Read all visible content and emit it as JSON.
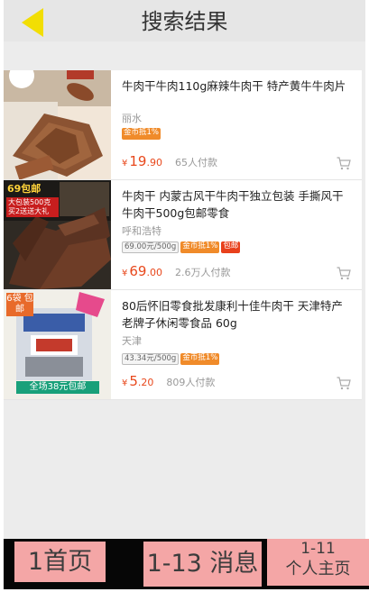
{
  "header": {
    "title": "搜索结果"
  },
  "colors": {
    "accent": "#e8481c",
    "back_arrow": "#f2de04",
    "tab_bg": "#f4a6a6",
    "coin_tag": "#f08b2a",
    "mail_tag": "#e8401c"
  },
  "results": [
    {
      "title": "牛肉干牛肉110g麻辣牛肉干 特产黄牛牛肉片",
      "location": "丽水",
      "tags": [
        "金币抵1%"
      ],
      "currency": "¥",
      "price_int": "19",
      "price_dec": ".90",
      "sales": "65人付款",
      "image": {
        "icon": "beef-jerky-image",
        "overlay": "",
        "promo": ""
      }
    },
    {
      "title": "牛肉干 内蒙古风干牛肉干独立包装 手撕风干牛肉干500g包邮零食",
      "location": "呼和浩特",
      "tags": [
        "69.00元/500g",
        "金币抵1%",
        "包邮"
      ],
      "currency": "¥",
      "price_int": "69",
      "price_dec": ".00",
      "sales": "2.6万人付款",
      "image": {
        "icon": "beef-jerky-image",
        "overlay": "69包邮",
        "promo": "大包装500克 买2送送大礼"
      }
    },
    {
      "title": "80后怀旧零食批发康利十佳牛肉干 天津特产老牌子休闲零食品 60g",
      "location": "天津",
      "tags": [
        "43.34元/500g",
        "金币抵1%"
      ],
      "currency": "¥",
      "price_int": "5",
      "price_dec": ".20",
      "sales": "809人付款",
      "image": {
        "icon": "snack-package-image",
        "overlay": "6袋 包邮",
        "promo": "全场38元包邮"
      }
    }
  ],
  "tabbar": {
    "home": "1首页",
    "messages": "1-13 消息",
    "profile_badge": "1-11",
    "profile": "个人主页"
  }
}
